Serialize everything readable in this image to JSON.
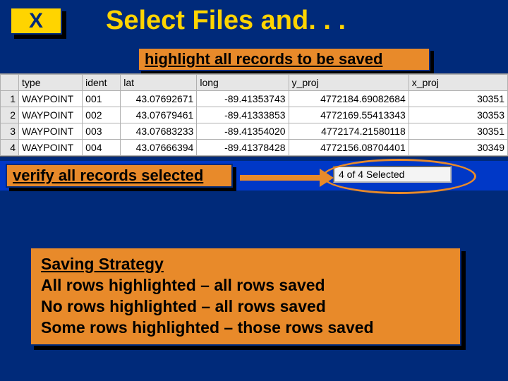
{
  "bullet": "X",
  "title": "Select Files and. . .",
  "callout1": "highlight all records to be saved",
  "callout2": "verify all records selected",
  "status_text": "4 of 4 Selected",
  "table": {
    "headers": {
      "corner": "",
      "type": "type",
      "ident": "ident",
      "lat": "lat",
      "long": "long",
      "y_proj": "y_proj",
      "x_proj": "x_proj"
    },
    "rows": [
      {
        "n": "1",
        "type": "WAYPOINT",
        "ident": "001",
        "lat": "43.07692671",
        "long": "-89.41353743",
        "y_proj": "4772184.69082684",
        "x_proj": "30351"
      },
      {
        "n": "2",
        "type": "WAYPOINT",
        "ident": "002",
        "lat": "43.07679461",
        "long": "-89.41333853",
        "y_proj": "4772169.55413343",
        "x_proj": "30353"
      },
      {
        "n": "3",
        "type": "WAYPOINT",
        "ident": "003",
        "lat": "43.07683233",
        "long": "-89.41354020",
        "y_proj": "4772174.21580118",
        "x_proj": "30351"
      },
      {
        "n": "4",
        "type": "WAYPOINT",
        "ident": "004",
        "lat": "43.07666394",
        "long": "-89.41378428",
        "y_proj": "4772156.08704401",
        "x_proj": "30349"
      }
    ]
  },
  "strategy": {
    "header": "Saving Strategy",
    "line1": "All rows highlighted – all rows saved",
    "line2": "No rows highlighted – all rows saved",
    "line3": "Some rows highlighted – those rows saved"
  }
}
